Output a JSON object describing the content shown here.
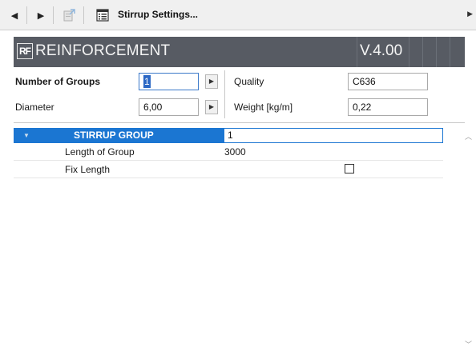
{
  "toolbar": {
    "back_icon": "◀",
    "forward_icon": "▶",
    "title": "Stirrup Settings...",
    "more_icon": "▶"
  },
  "banner": {
    "logo": "RF",
    "title": "REINFORCEMENT",
    "version": "V.4.00"
  },
  "form": {
    "groups_label": "Number of Groups",
    "groups_value": "1",
    "diameter_label": "Diameter",
    "diameter_value": "6,00",
    "quality_label": "Quality",
    "quality_value": "C636",
    "weight_label": "Weight [kg/m]",
    "weight_value": "0,22",
    "arrow_icon": "▶"
  },
  "group_list": {
    "collapse_icon": "▼",
    "group_label": "STIRRUP GROUP",
    "group_value": "1",
    "properties": [
      {
        "key": "Length of Group",
        "value": "3000"
      },
      {
        "key": "Fix Length",
        "value": ""
      }
    ],
    "fix_length_checked": false
  },
  "scrollbar": {
    "up_icon": "︿",
    "down_icon": "﹀"
  }
}
